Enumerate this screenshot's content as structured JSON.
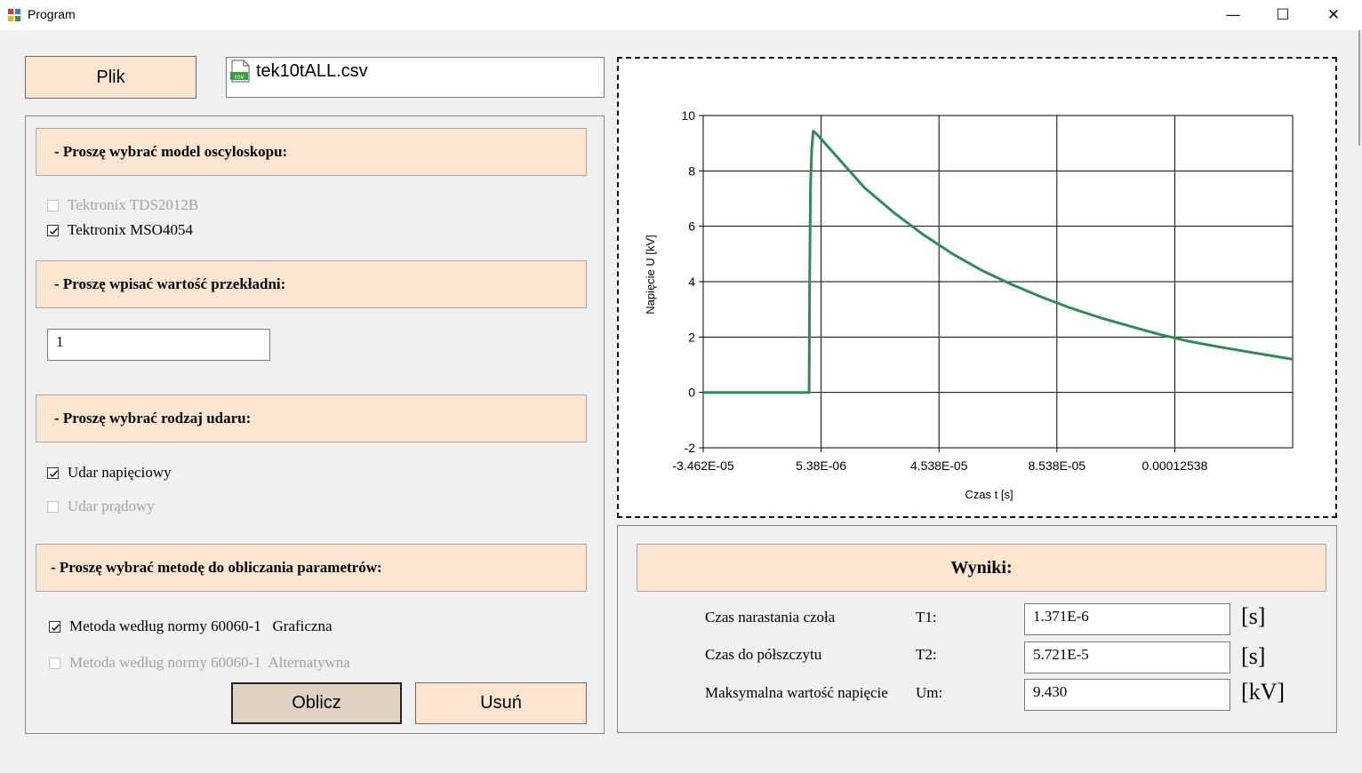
{
  "window": {
    "title": "Program",
    "controls": [
      "—",
      "☐",
      "✕"
    ]
  },
  "file": {
    "button_label": "Plik",
    "name": "tek10tALL.csv",
    "icon": "csv-file-icon"
  },
  "left": {
    "oscilloscope": {
      "header": "- Proszę wybrać model oscyloskopu:",
      "options": [
        {
          "label": "Tektronix TDS2012B",
          "checked": false,
          "enabled": false
        },
        {
          "label": "Tektronix MSO4054",
          "checked": true,
          "enabled": true
        }
      ]
    },
    "ratio": {
      "header": "- Proszę wpisać wartość przekładni:",
      "value": "1"
    },
    "surge": {
      "header": "- Proszę wybrać rodzaj udaru:",
      "options": [
        {
          "label": "Udar napięciowy",
          "checked": true,
          "enabled": true
        },
        {
          "label": "Udar prądowy",
          "checked": false,
          "enabled": false
        }
      ]
    },
    "method": {
      "header": "- Proszę wybrać metodę do obliczania parametrów:",
      "options": [
        {
          "label": "Metoda według normy 60060-1   Graficzna",
          "checked": true,
          "enabled": true
        },
        {
          "label": "Metoda według normy 60060-1  Alternatywna",
          "checked": false,
          "enabled": false
        }
      ]
    },
    "calculate_label": "Oblicz",
    "delete_label": "Usuń"
  },
  "results": {
    "header": "Wyniki:",
    "rows": [
      {
        "label": "Czas narastania czoła",
        "symbol": "T1:",
        "value": "1.371E-6",
        "unit": "[s]"
      },
      {
        "label": "Czas do półszczytu",
        "symbol": "T2:",
        "value": "5.721E-5",
        "unit": "[s]"
      },
      {
        "label": "Maksymalna wartość napięcie",
        "symbol": "Um:",
        "value": "9.430",
        "unit": "[kV]"
      }
    ]
  },
  "chart_data": {
    "type": "line",
    "xlabel": "Czas t [s]",
    "ylabel": "Napięcie U [kV]",
    "xlim": [
      -3.462e-05,
      0.00016538
    ],
    "ylim": [
      -2,
      10
    ],
    "xticks": [
      -3.462e-05,
      5.38e-06,
      4.538e-05,
      8.538e-05,
      0.00012538
    ],
    "xtick_labels": [
      "-3.462E-05",
      "5.38E-06",
      "4.538E-05",
      "8.538E-05",
      "0.00012538"
    ],
    "yticks": [
      -2,
      0,
      2,
      4,
      6,
      8,
      10
    ],
    "ytick_labels": [
      "-2",
      "0",
      "2",
      "4",
      "6",
      "8",
      "10"
    ],
    "grid": true,
    "color": "#2e8b57",
    "series": [
      {
        "x": [
          -3.462e-05,
          -2e-05,
          -1e-05,
          0.0,
          1.3e-06,
          1.5e-06,
          1.8e-06,
          2.2e-06,
          2.7e-06,
          3.2e-06,
          5e-06,
          1e-05,
          1.5e-05,
          2e-05,
          3e-05,
          4e-05,
          5e-05,
          6e-05,
          7e-05,
          8e-05,
          9e-05,
          0.0001,
          0.00011,
          0.00012,
          0.00013,
          0.00014,
          0.00015,
          0.00016538
        ],
        "y": [
          0.0,
          0.0,
          0.0,
          0.0,
          0.0,
          4.0,
          7.5,
          8.8,
          9.43,
          9.4,
          9.2,
          8.6,
          8.0,
          7.4,
          6.5,
          5.7,
          5.0,
          4.4,
          3.9,
          3.45,
          3.05,
          2.7,
          2.4,
          2.1,
          1.85,
          1.65,
          1.47,
          1.2
        ]
      }
    ]
  }
}
